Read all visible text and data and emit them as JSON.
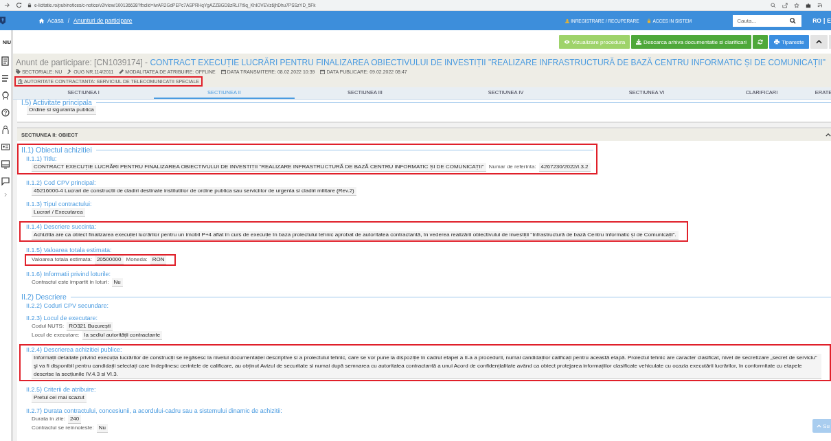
{
  "browser": {
    "url": "e-licitatie.ro/pub/notices/c-notice/v2/view/100136638?fbclid=IwAR2GdPEPc7ASPRHqYgAZZBGD8zRLI7t9q_KhIOVEVz6jhDhu7PSSzYD_5Fk"
  },
  "header": {
    "breadcrumb": [
      {
        "label": "Acasa"
      },
      {
        "label": "Anunturi de participare"
      }
    ],
    "breadcrumb_separator": "/",
    "links": [
      "INREGISTRARE / RECUPERARE",
      "ACCES IN SISTEM"
    ],
    "search": {
      "placeholder": "Cauta..."
    },
    "languages": [
      "RO",
      "E"
    ],
    "language_separator": "|"
  },
  "sidebar": {
    "label": "NIU"
  },
  "toolbar": [
    {
      "kind": "light",
      "label": "Vizualizare procedura"
    },
    {
      "kind": "green",
      "label": "Descarca arhiva documentatie si clarificari"
    },
    {
      "kind": "refresh"
    },
    {
      "kind": "print",
      "label": "Tipareste"
    },
    {
      "kind": "collapse"
    }
  ],
  "notice": {
    "prefix": "Anunt de participare: [CN1039174] - ",
    "title": "CONTRACT EXECUȚIE LUCRĂRI PENTRU FINALIZAREA OBIECTIVULUI DE INVESTIȚII \"REALIZARE INFRASTRUCTURĂ DE BAZĂ CENTRU INFORMATIC ȘI DE COMUNICAȚII\"",
    "meta": [
      "SECTORIALE: NU",
      "OUG NR.114/2011",
      "MODALITATEA DE ATRIBUIRE: OFFLINE",
      "DATA TRANSMITERE: 08.02.2022 10:39",
      "DATA PUBLICARE: 09.02.2022 08:47"
    ],
    "authority": {
      "text": "AUTORITATE CONTRACTANTA: SERVICIUL DE TELECOMUNICATII SPECIALE",
      "highlighted": true
    }
  },
  "tabs": [
    {
      "label": "SECTIUNEA I",
      "selected": false
    },
    {
      "label": "SECTIUNEA II",
      "selected": true
    },
    {
      "label": "SECTIUNEA III",
      "selected": false
    },
    {
      "label": "SECTIUNEA IV",
      "selected": false
    },
    {
      "label": "SECTIUNEA VI",
      "selected": false
    },
    {
      "label": "CLARIFICARI",
      "selected": false
    },
    {
      "label": "ERATE",
      "selected": false
    }
  ],
  "previous_card": {
    "heading": "I.5) Activitate principala",
    "value": "Ordine si siguranta publica"
  },
  "section": {
    "title": "SECTIUNEA II: OBIECT",
    "groups": [
      {
        "heading": "II.1) Obiectul achizitiei",
        "highlighted": true,
        "items": [
          {
            "label": "II.1.1) Titlu:",
            "lines": [
              {
                "parts": [
                  {
                    "kind": "value",
                    "text": "CONTRACT EXECUȚIE LUCRĂRI PENTRU FINALIZAREA OBIECTIVULUI DE INVESTIȚII \"REALIZARE INFRASTRUCTURĂ DE BAZĂ CENTRU INFORMATIC ȘI DE COMUNICAȚII\""
                  },
                  {
                    "kind": "label",
                    "text": "Numar de referinta:"
                  },
                  {
                    "kind": "value",
                    "text": "4267230/2022/I.3.2"
                  }
                ]
              }
            ]
          },
          {
            "label": "II.1.2) Cod CPV principal:",
            "lines": [
              {
                "parts": [
                  {
                    "kind": "value",
                    "text": "45216000-4 Lucrari de constructii de cladiri destinate institutiilor de ordine publica sau serviciilor de urgenta si cladiri militare (Rev.2)"
                  }
                ]
              }
            ]
          },
          {
            "label": "II.1.3) Tipul contractului:",
            "lines": [
              {
                "parts": [
                  {
                    "kind": "value",
                    "text": "Lucrari / Executarea"
                  }
                ]
              }
            ]
          },
          {
            "label": "II.1.4) Descriere succinta:",
            "highlighted": true,
            "lines": [
              {
                "parts": [
                  {
                    "kind": "value",
                    "text": "Achizitia are ca obiect finalizarea execuției lucrărilor pentru un imobil P+4 aflat în curs de execuție în baza proiectului tehnic aprobat de autoritatea contractantă, în vederea realizării obiectivului de investiții \"Infrastructură de bază Centru Informatic și de Comunicații\"."
                  }
                ]
              }
            ]
          },
          {
            "label": "II.1.5) Valoarea totala estimata:",
            "values_highlighted": true,
            "lines": [
              {
                "parts": [
                  {
                    "kind": "label",
                    "text": "Valoarea totala estimata:"
                  },
                  {
                    "kind": "value",
                    "text": "20500000"
                  },
                  {
                    "kind": "label",
                    "text": "Moneda:"
                  },
                  {
                    "kind": "value",
                    "text": "RON"
                  }
                ]
              }
            ]
          },
          {
            "label": "II.1.6) Informatii privind loturile:",
            "lines": [
              {
                "parts": [
                  {
                    "kind": "label",
                    "text": "Contractul este impartit in loturi:"
                  },
                  {
                    "kind": "value",
                    "text": "Nu"
                  }
                ]
              }
            ]
          }
        ]
      },
      {
        "heading": "II.2) Descriere",
        "highlighted": false,
        "items": [
          {
            "label": "II.2.2) Coduri CPV secundare:"
          },
          {
            "label": "II.2.3) Locul de executare:",
            "lines": [
              {
                "parts": [
                  {
                    "kind": "label",
                    "text": "Codul NUTS:"
                  },
                  {
                    "kind": "value",
                    "text": "RO321 București"
                  }
                ]
              },
              {
                "parts": [
                  {
                    "kind": "label",
                    "text": "Locul de executare:"
                  },
                  {
                    "kind": "value",
                    "text": "la sediul autorității contractante"
                  }
                ]
              }
            ]
          },
          {
            "label": "II.2.4) Descrierea achizitiei publice:",
            "highlighted": true,
            "lines": [
              {
                "parts": [
                  {
                    "kind": "value",
                    "text": "Informații detaliate privind execuția lucrărilor de construcții se regăsesc la nivelul documentației descriptive si a proiectului tehnic, care se vor pune la dispoziție în cadrul etapei a II-a a procedurii, numai candidaților calificați pentru această etapă. Proiectul tehnic are caracter clasificat, nivel de secretizare „secret de serviciu” şi va fi disponibil pentru candidații selectați care îndeplinesc cerintele de calificare, au obținut Avizul de securitate si numai după semnarea cu autoritatea contractantă a unui Acord de confidențialitate având ca obiect protejarea informațiilor clasificate vehiculate cu ocazia executării lucrărilor, în conformitate cu etapele descrise la secțiunile IV.4.3 si VI.3."
                  }
                ]
              }
            ]
          },
          {
            "label": "II.2.5) Criterii de atribuire:",
            "lines": [
              {
                "parts": [
                  {
                    "kind": "value",
                    "text": "Pretul cel mai scazut"
                  }
                ]
              }
            ]
          },
          {
            "label": "II.2.7) Durata contractului, concesiunii, a acordului-cadru sau a sistemului dinamic de achizitii:",
            "lines": [
              {
                "parts": [
                  {
                    "kind": "label",
                    "text": "Durata in zile:"
                  },
                  {
                    "kind": "value",
                    "text": "240"
                  }
                ]
              },
              {
                "parts": [
                  {
                    "kind": "label",
                    "text": "Contractul se reinnoieste:"
                  },
                  {
                    "kind": "value",
                    "text": "Nu"
                  }
                ]
              }
            ]
          }
        ]
      }
    ]
  },
  "back_to_top": {
    "label": "Su"
  }
}
